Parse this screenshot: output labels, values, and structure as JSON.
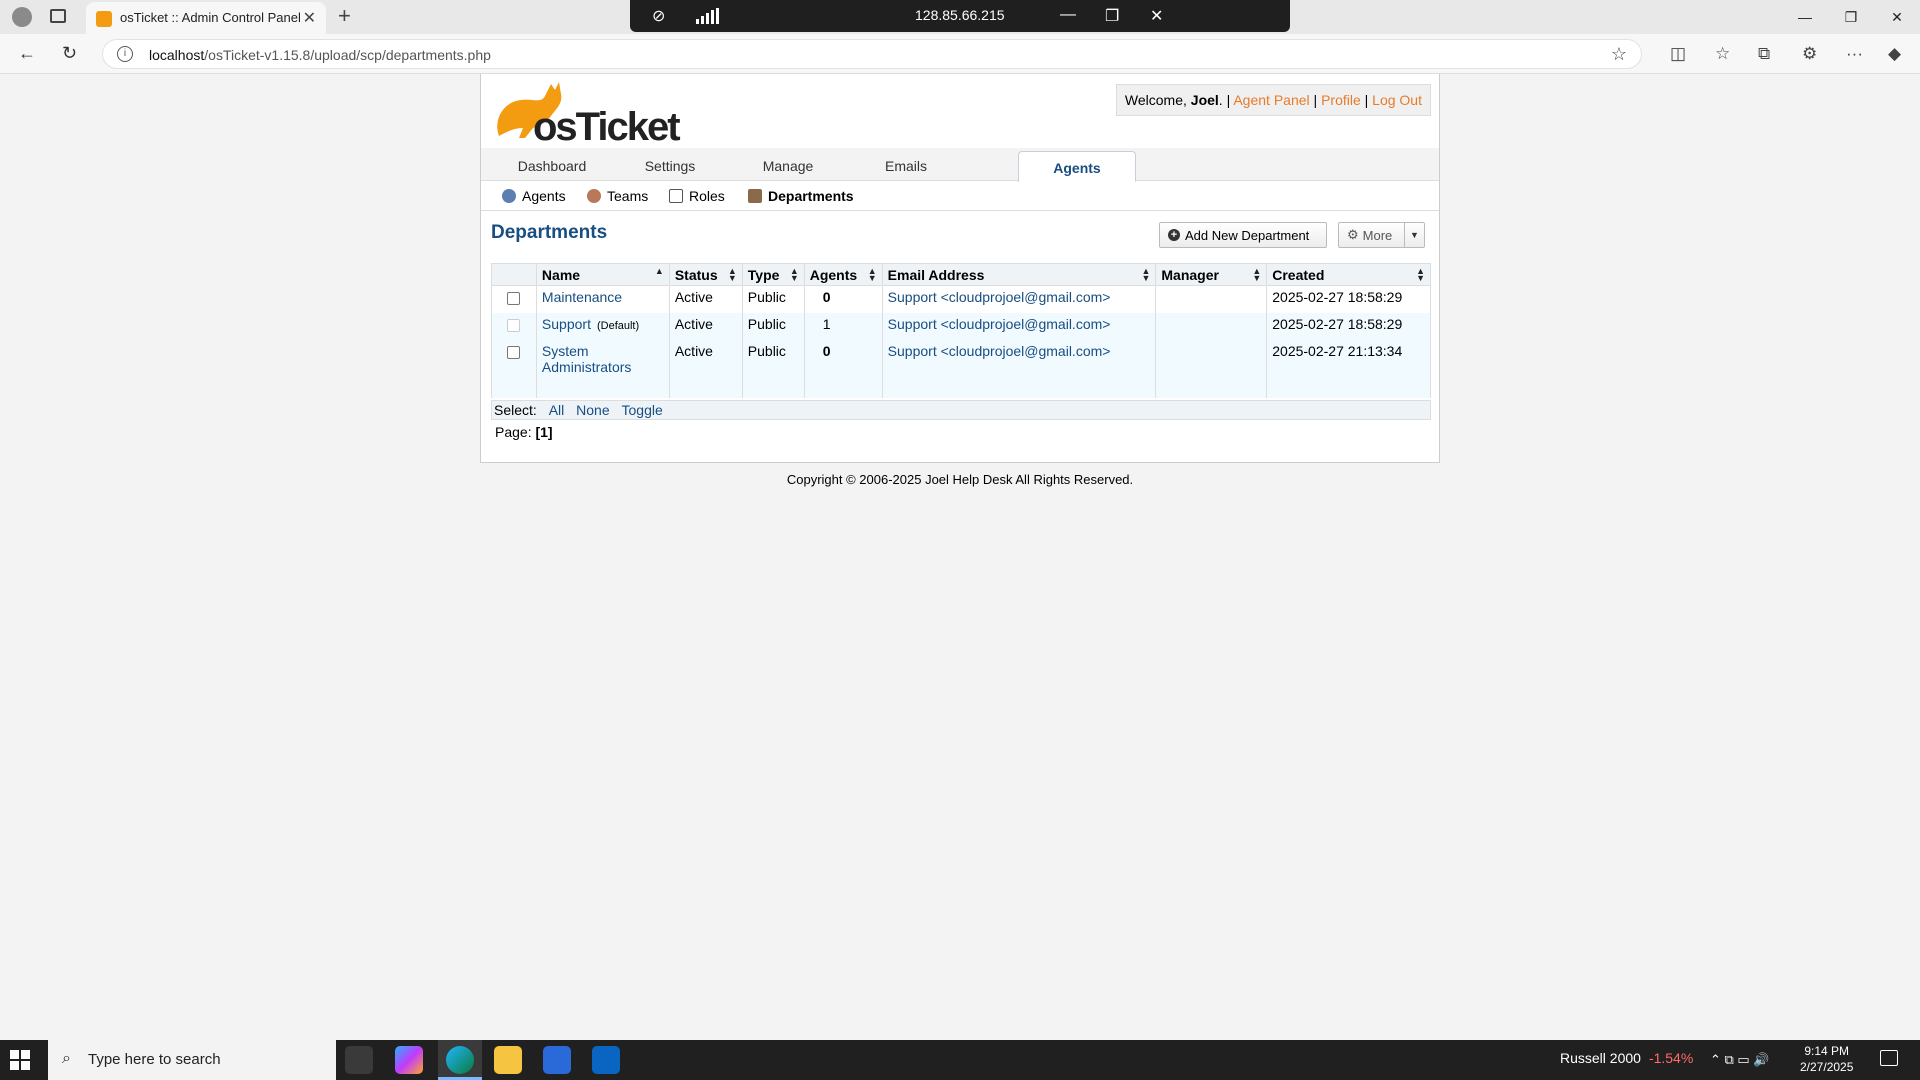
{
  "browser": {
    "tab_title": "osTicket :: Admin Control Panel",
    "url_host": "localhost",
    "url_path": "/osTicket-v1.15.8/upload/scp/departments.php",
    "remote_ip": "128.85.66.215"
  },
  "header": {
    "logo_text": "osTicket",
    "welcome_prefix": "Welcome, ",
    "user": "Joel",
    "welcome_suffix": ".",
    "links": [
      "Agent Panel",
      "Profile",
      "Log Out"
    ],
    "separator": "|"
  },
  "nav": {
    "tabs": [
      "Dashboard",
      "Settings",
      "Manage",
      "Emails",
      "Agents"
    ],
    "active": "Agents"
  },
  "subnav": {
    "items": [
      "Agents",
      "Teams",
      "Roles",
      "Departments"
    ],
    "active": "Departments"
  },
  "page": {
    "title": "Departments",
    "add_button": "Add New Department",
    "more_button": "More"
  },
  "table": {
    "columns": [
      "Name",
      "Status",
      "Type",
      "Agents",
      "Email Address",
      "Manager",
      "Created"
    ],
    "rows": [
      {
        "name": "Maintenance",
        "default_tag": "",
        "status": "Active",
        "type": "Public",
        "agents": "0",
        "email": "Support <cloudprojoel@gmail.com>",
        "manager": "",
        "created": "2025-02-27 18:58:29"
      },
      {
        "name": "Support",
        "default_tag": "(Default)",
        "status": "Active",
        "type": "Public",
        "agents": "1",
        "email": "Support <cloudprojoel@gmail.com>",
        "manager": "",
        "created": "2025-02-27 18:58:29"
      },
      {
        "name": "System Administrators",
        "default_tag": "",
        "status": "Active",
        "type": "Public",
        "agents": "0",
        "email": "Support <cloudprojoel@gmail.com>",
        "manager": "",
        "created": "2025-02-27 21:13:34"
      }
    ]
  },
  "select_bar": {
    "label": "Select:",
    "options": [
      "All",
      "None",
      "Toggle"
    ]
  },
  "pager": {
    "label": "Page:",
    "current": "[1]"
  },
  "footer": {
    "copyright": "Copyright © 2006-2025 Joel Help Desk All Rights Reserved."
  },
  "taskbar": {
    "search_placeholder": "Type here to search",
    "ticker_name": "Russell 2000",
    "ticker_change": "-1.54%",
    "time": "9:14 PM",
    "date": "2/27/2025"
  }
}
